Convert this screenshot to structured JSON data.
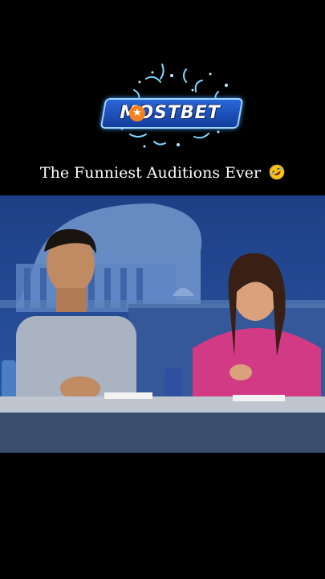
{
  "logo": {
    "brand_text": "MOSTBET",
    "brand_color": "#1d4fbf",
    "accent_color": "#f58220"
  },
  "caption": {
    "text": "The Funniest Auditions Ever",
    "emoji_icon": "rolling-on-floor-laughing-emoji"
  },
  "video_frame": {
    "scene": "judges-panel-still"
  }
}
